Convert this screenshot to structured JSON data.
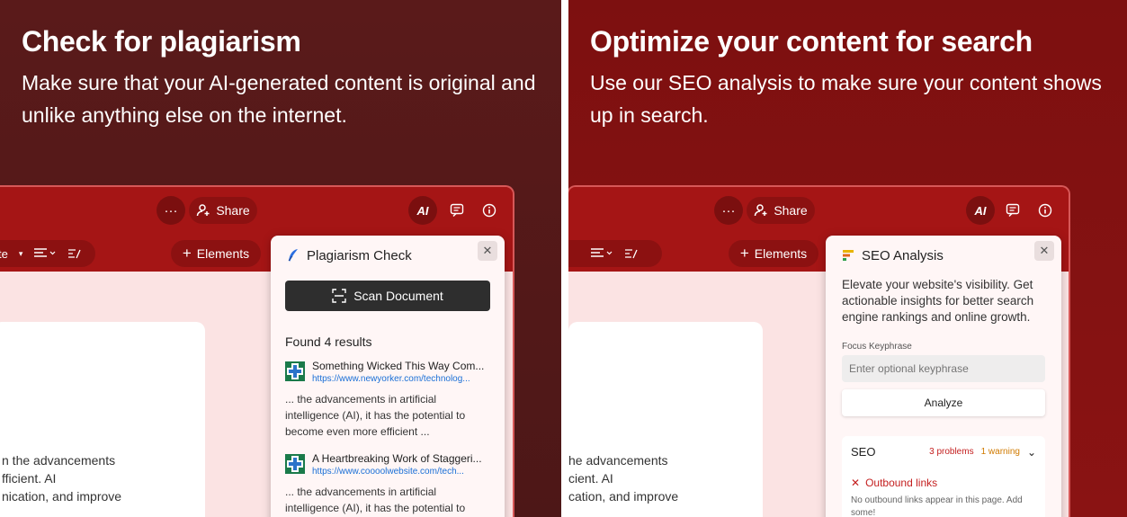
{
  "left": {
    "headline": "Check for plagiarism",
    "subtitle": "Make sure that your AI-generated content is original and unlike anything else on the internet.",
    "topbar": {
      "more_label": "···",
      "share_label": "Share"
    },
    "toolbar": {
      "style_label": "te",
      "elements_label": "Elements"
    },
    "doc_lines": [
      "n the advancements",
      "fficient. AI",
      "nication, and improve"
    ],
    "panel": {
      "title": "Plagiarism Check",
      "scan_label": "Scan Document",
      "found_label": "Found 4 results",
      "results": [
        {
          "title": "Something Wicked This Way Com...",
          "url": "https://www.newyorker.com/technolog...",
          "snippet": "... the advancements in artificial intelligence (AI), it has the potential to become even more efficient ..."
        },
        {
          "title": "A Heartbreaking Work of Staggeri...",
          "url": "https://www.coooolwebsite.com/tech...",
          "snippet": "... the advancements in artificial intelligence (AI), it has the potential to"
        }
      ]
    }
  },
  "right": {
    "headline": "Optimize your content for search",
    "subtitle": "Use our SEO analysis to make sure your content shows up in search.",
    "topbar": {
      "more_label": "···",
      "share_label": "Share"
    },
    "toolbar": {
      "elements_label": "Elements"
    },
    "doc_lines": [
      "he advancements",
      "cient. AI",
      "cation, and improve"
    ],
    "panel": {
      "title": "SEO Analysis",
      "description": "Elevate your website's visibility. Get actionable insights for better search engine rankings and online growth.",
      "keyphrase_label": "Focus Keyphrase",
      "keyphrase_placeholder": "Enter optional keyphrase",
      "analyze_label": "Analyze",
      "seo": {
        "title": "SEO",
        "problems": "3 problems",
        "warnings": "1 warning",
        "issue_title": "Outbound links",
        "issue_desc": "No outbound links appear in this page. Add some!"
      }
    }
  },
  "colors": {
    "left_bg": "#5a1a1a",
    "right_bg": "#7d1010",
    "app_red": "#a51515",
    "canvas_pink": "#fbe3e3",
    "link_blue": "#1a6fd6",
    "problem_red": "#c42020",
    "warning_orange": "#d07a00"
  }
}
